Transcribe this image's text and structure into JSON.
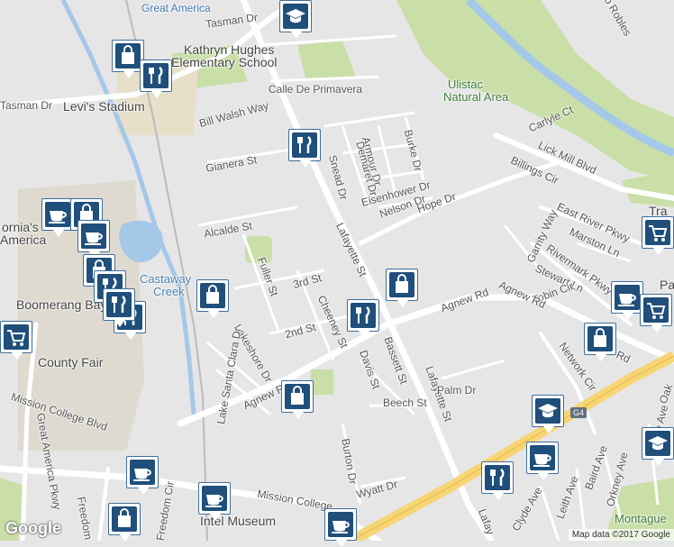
{
  "map": {
    "background_color": "#e6e6e6",
    "road_color": "#ffffff",
    "highway_color": "#f7d575",
    "water_color": "#a5c8e8",
    "park_color": "#c9dfa7",
    "marker_color": "#1f4f7a"
  },
  "labels": {
    "great_america_top": "Great America",
    "tasman_dr_top": "Tasman Dr",
    "kathryn_hughes_1": "Kathryn Hughes",
    "kathryn_hughes_2": "Elementary School",
    "tasman_dr_left": "Tasman Dr",
    "levis_stadium": "Levi's Stadium",
    "calle_de_primavera": "Calle De Primavera",
    "bill_walsh_way": "Bill Walsh Way",
    "ulistac_1": "Ulistac",
    "ulistac_2": "Natural Area",
    "lo_robles": "lo Robles",
    "carlyle_ct": "Carlyle Ct",
    "lick_mill_blvd": "Lick Mill Blvd",
    "billings_cir": "Billings Cir",
    "armour_dr": "Armour Dr",
    "burke_dr": "Burke Dr",
    "demaret_dr": "Demaret Dr",
    "snead_dr": "Snead Dr",
    "eisenhower_dr": "Eisenhower Dr",
    "nelson_dr": "Nelson Dr",
    "hope_dr": "Hope Dr",
    "gianera_st": "Gianera St",
    "alcalde_st": "Alcalde St",
    "california_1": "ornia's",
    "california_2": "America",
    "lafayette_st_1": "Lafayette St",
    "garrity_way": "Garrity Way",
    "east_river_pkwy": "East River Pkwy",
    "marston_ln": "Marston Ln",
    "rivermark_pkwy": "Rivermark Pkwy",
    "stewart_ln": "Stewart Ln",
    "tobin_cir": "Tobin Cir",
    "fuller_st": "Fuller St",
    "third_st": "3rd St",
    "castaway_1": "Castaway",
    "castaway_2": "Creek",
    "boomerang_bay": "Boomerang Bay",
    "agnew_rd_center": "Agnew Rd",
    "agnew_rd_right": "Agnew Rd",
    "cheeney_st": "Cheeney St",
    "second_st": "2nd St",
    "lakeshore_dr": "Lakeshore Dr",
    "county_fair": "County Fair",
    "davis_st": "Davis St",
    "bassett_st": "Bassett St",
    "lafayette_st_2": "Lafayette St",
    "network_cir": "Network Cir",
    "mission_college_blvd": "Mission College Blvd",
    "lake_santa_clara": "Lake Santa Clara Dr",
    "agnew_rd_left": "Agnew Rd",
    "beech_st": "Beech St",
    "palm_dr": "Palm Dr",
    "g4": "G4",
    "great_america_pkwy": "Great America Pkwy",
    "burton_dr": "Burton Dr",
    "wyatt_dr": "Wyatt Dr",
    "clyde_ave": "Clyde Ave",
    "leith_ave": "Leith Ave",
    "baird_ave": "Baird Ave",
    "orkney_ave": "Orkney Ave",
    "laurie_ave": "Laurie Ave",
    "freedom_cir": "Freedom Cir",
    "freedom": "Freedom",
    "mission_college": "Mission College",
    "intel_museum": "Intel Museum",
    "lafay": "Lafay",
    "tra": "Tra",
    "pa": "Pa",
    "oak": "Oak",
    "rd": "Rd",
    "montague": "Montague"
  },
  "markers": [
    {
      "icon": "school-icon"
    },
    {
      "icon": "shopping-bag-icon"
    },
    {
      "icon": "restaurant-icon"
    },
    {
      "icon": "restaurant-icon"
    },
    {
      "icon": "cafe-icon"
    },
    {
      "icon": "shopping-bag-icon"
    },
    {
      "icon": "cafe-icon"
    },
    {
      "icon": "shopping-bag-icon"
    },
    {
      "icon": "restaurant-icon"
    },
    {
      "icon": "restaurant-icon"
    },
    {
      "icon": "shopping-bag-icon"
    },
    {
      "icon": "restaurant-icon"
    },
    {
      "icon": "shopping-bag-icon"
    },
    {
      "icon": "shopping-cart-icon"
    },
    {
      "icon": "restaurant-icon"
    },
    {
      "icon": "shopping-bag-icon"
    },
    {
      "icon": "school-icon"
    },
    {
      "icon": "cafe-icon"
    },
    {
      "icon": "restaurant-icon"
    },
    {
      "icon": "cafe-icon"
    },
    {
      "icon": "cafe-icon"
    },
    {
      "icon": "shopping-bag-icon"
    },
    {
      "icon": "cafe-icon"
    },
    {
      "icon": "shopping-bag-icon"
    },
    {
      "icon": "cafe-icon"
    },
    {
      "icon": "shopping-cart-icon"
    },
    {
      "icon": "school-icon"
    },
    {
      "icon": "shopping-cart-icon"
    }
  ],
  "footer": {
    "logo": "Google",
    "attribution": "Map data ©2017 Google"
  }
}
